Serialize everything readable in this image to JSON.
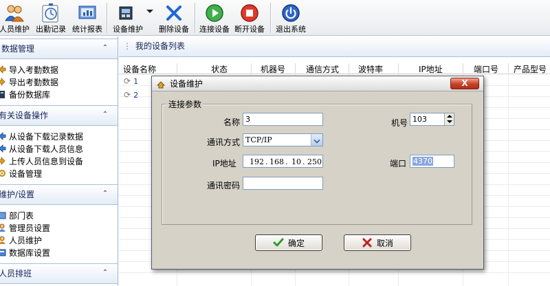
{
  "toolbar": {
    "buttons": [
      {
        "label": "人员维护",
        "icon": "users-icon"
      },
      {
        "label": "出勤记录",
        "icon": "stopwatch-icon"
      },
      {
        "label": "统计报表",
        "icon": "report-icon"
      },
      {
        "label": "设备维护",
        "icon": "device-icon"
      },
      {
        "label": "删除设备",
        "icon": "delete-x-icon"
      },
      {
        "label": "连接设备",
        "icon": "connect-play-icon"
      },
      {
        "label": "断开设备",
        "icon": "disconnect-stop-icon"
      },
      {
        "label": "退出系统",
        "icon": "power-icon"
      }
    ]
  },
  "sidebar": {
    "sections": [
      {
        "title": "数据管理",
        "items": [
          "导入考勤数据",
          "导出考勤数据",
          "备份数据库"
        ]
      },
      {
        "title": "有关设备操作",
        "items": [
          "从设备下载记录数据",
          "从设备下载人员信息",
          "上传人员信息到设备",
          "设备管理"
        ]
      },
      {
        "title": "维护/设置",
        "items": [
          "部门表",
          "管理员设置",
          "人员维护",
          "数据库设置"
        ]
      },
      {
        "title": "人员排班",
        "items": []
      }
    ]
  },
  "main": {
    "title": "我的设备列表",
    "columns": [
      "设备名称",
      "状态",
      "机器号",
      "通信方式",
      "波特率",
      "IP地址",
      "端口号",
      "产品型号"
    ],
    "rows": [
      {
        "name": "1"
      },
      {
        "name": "2"
      }
    ]
  },
  "dialog": {
    "title": "设备维护",
    "close_label": "X",
    "group_title": "连接参数",
    "name_label": "名称",
    "name_value": "3",
    "machine_label": "机号",
    "machine_value": "103",
    "comm_label": "通讯方式",
    "comm_value": "TCP/IP",
    "ip_label": "IP地址",
    "ip_parts": [
      "192",
      "168",
      "10",
      "250"
    ],
    "port_label": "端口",
    "port_value": "4370",
    "password_label": "通讯密码",
    "password_value": "",
    "ok_label": "确定",
    "cancel_label": "取消"
  },
  "colors": {
    "sidebar_header_text": "#15235a",
    "close_button": "#c7412a",
    "ok_check": "#2f9a2f",
    "cancel_x": "#c02020",
    "selection": "#8aa6e0"
  }
}
